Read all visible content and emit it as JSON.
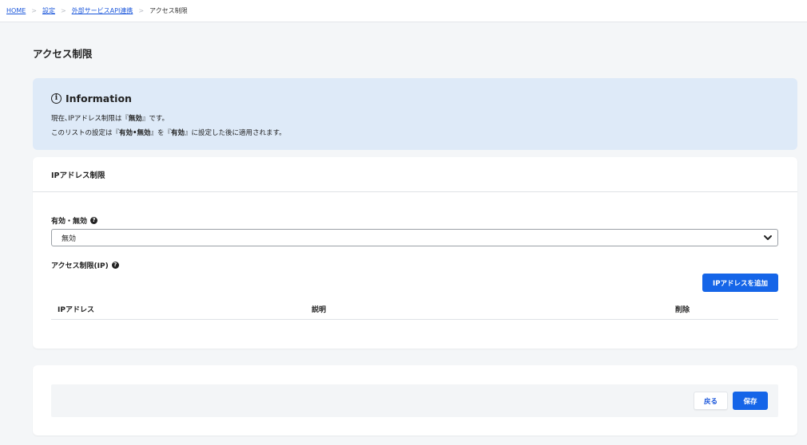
{
  "breadcrumb": {
    "items": [
      {
        "label": "HOME",
        "link": true
      },
      {
        "label": "設定",
        "link": true
      },
      {
        "label": "外部サービスAPI連携",
        "link": true
      },
      {
        "label": "アクセス制限",
        "link": false
      }
    ],
    "separator": ">"
  },
  "page": {
    "title": "アクセス制限"
  },
  "info": {
    "title": "Information",
    "line1": {
      "pre": "現在､IPアドレス制限は『",
      "bold": "無効",
      "post": "』です。"
    },
    "line2": {
      "pre": "このリストの設定は『",
      "bold1": "有効•無効",
      "mid": "』を『",
      "bold2": "有効",
      "post": "』に設定した後に適用されます。"
    }
  },
  "ip_section": {
    "header": "IPアドレス制限",
    "enable_label": "有効・無効",
    "enable_value": "無効",
    "access_label": "アクセス制限(IP)",
    "add_button": "IPアドレスを追加",
    "columns": [
      "IPアドレス",
      "説明",
      "削除"
    ]
  },
  "actions": {
    "back": "戻る",
    "save": "保存"
  },
  "colors": {
    "accent": "#1565e8",
    "info_bg": "#deeaf8",
    "page_bg": "#f4f6f8"
  },
  "icons": {
    "info": "info-circle-icon",
    "help": "question-circle-icon",
    "select": "chevron-down-icon"
  }
}
